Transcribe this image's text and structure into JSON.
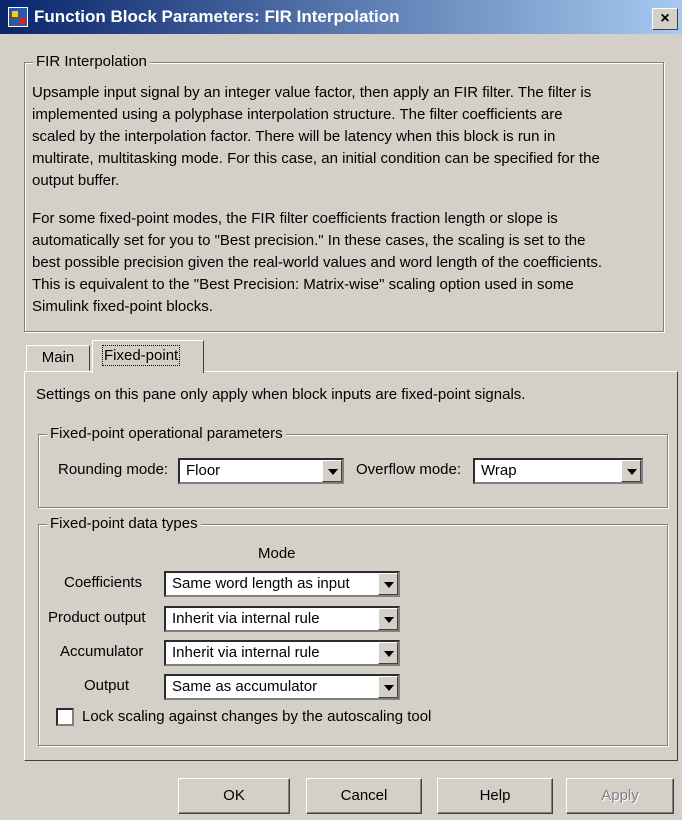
{
  "window": {
    "title": "Function Block Parameters: FIR Interpolation",
    "close_glyph": "×"
  },
  "group": {
    "legend": "FIR Interpolation",
    "paragraph1_lines": [
      "Upsample input signal by an integer value factor, then apply an FIR filter.  The filter is",
      "implemented using a polyphase interpolation structure.  The filter coefficients are",
      "scaled by the interpolation factor.  There will be latency when this block is run in",
      "multirate, multitasking mode.  For this case, an initial condition can be specified for the",
      "output buffer."
    ],
    "paragraph2_lines": [
      "For some fixed-point modes, the FIR filter coefficients fraction length or slope is",
      "automatically set for you to \"Best precision.\" In these cases, the scaling is set to the",
      "best possible precision given the real-world values and word length of the coefficients.",
      "This is equivalent to the \"Best Precision: Matrix-wise\" scaling option used in some",
      "Simulink fixed-point blocks."
    ]
  },
  "tabs": [
    {
      "label": "Main",
      "selected": false
    },
    {
      "label": "Fixed-point",
      "selected": true
    }
  ],
  "fixed_point_pane": {
    "note": "Settings on this pane only apply when block inputs are fixed-point signals.",
    "operational": {
      "legend": "Fixed-point operational parameters",
      "rounding_label": "Rounding mode:",
      "rounding_value": "Floor",
      "overflow_label": "Overflow mode:",
      "overflow_value": "Wrap"
    },
    "datatypes": {
      "legend": "Fixed-point data types",
      "mode_header": "Mode",
      "rows": [
        {
          "label": "Coefficients",
          "value": "Same word length as input"
        },
        {
          "label": "Product output",
          "value": "Inherit via internal rule"
        },
        {
          "label": "Accumulator",
          "value": "Inherit via internal rule"
        },
        {
          "label": "Output",
          "value": "Same as accumulator"
        }
      ],
      "lock_label": "Lock scaling against changes by the autoscaling tool",
      "lock_checked": false
    }
  },
  "buttons": {
    "ok": "OK",
    "cancel": "Cancel",
    "help": "Help",
    "apply": "Apply"
  },
  "colors": {
    "face": "#d4d0c8",
    "title_start": "#0a246a",
    "title_end": "#a6caf0"
  }
}
